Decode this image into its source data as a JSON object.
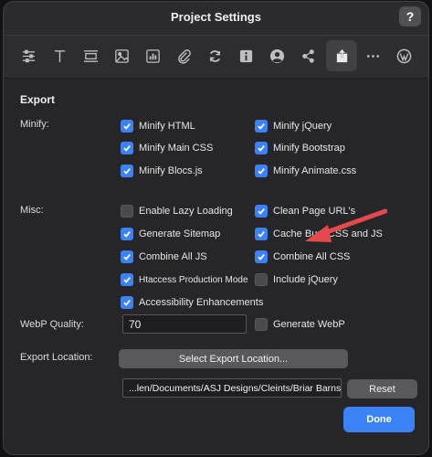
{
  "window": {
    "title": "Project Settings",
    "help_label": "?"
  },
  "toolbar": {
    "icons": [
      "sliders-icon",
      "text-icon",
      "layout-icon",
      "image-icon",
      "chart-icon",
      "attachment-icon",
      "sync-icon",
      "info-icon",
      "user-icon",
      "share-icon",
      "export-icon",
      "more-icon",
      "wordpress-icon"
    ],
    "active": "export-icon"
  },
  "export": {
    "section_title": "Export",
    "minify": {
      "label": "Minify:",
      "options": [
        {
          "label": "Minify HTML",
          "checked": true
        },
        {
          "label": "Minify jQuery",
          "checked": true
        },
        {
          "label": "Minify Main CSS",
          "checked": true
        },
        {
          "label": "Minify Bootstrap",
          "checked": true
        },
        {
          "label": "Minify Blocs.js",
          "checked": true
        },
        {
          "label": "Minify Animate.css",
          "checked": true
        }
      ]
    },
    "misc": {
      "label": "Misc:",
      "options": [
        {
          "label": "Enable Lazy Loading",
          "checked": false
        },
        {
          "label": "Clean Page URL's",
          "checked": true
        },
        {
          "label": "Generate Sitemap",
          "checked": true
        },
        {
          "label": "Cache Bust CSS and JS",
          "checked": true
        },
        {
          "label": "Combine All JS",
          "checked": true
        },
        {
          "label": "Combine All CSS",
          "checked": true
        },
        {
          "label": "Htaccess Production Mode",
          "checked": true
        },
        {
          "label": "Include jQuery",
          "checked": false
        },
        {
          "label": "Accessibility Enhancements",
          "checked": true
        }
      ]
    },
    "webp": {
      "label": "WebP Quality:",
      "value": "70",
      "generate_label": "Generate WebP",
      "generate_checked": false
    },
    "location": {
      "label": "Export Location:",
      "select_button": "Select Export Location...",
      "path": "...len/Documents/ASJ Designs/Cleints/Briar Barns",
      "reset_button": "Reset"
    },
    "done_button": "Done"
  },
  "colors": {
    "accent": "#3b82f6",
    "annotation_arrow": "#e5484d"
  }
}
